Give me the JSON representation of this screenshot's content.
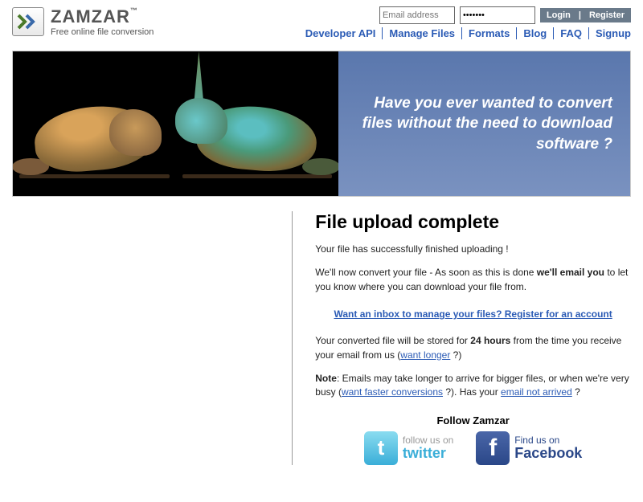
{
  "brand": {
    "name": "ZAMZAR",
    "tm": "™",
    "tagline": "Free online file conversion"
  },
  "login": {
    "email_placeholder": "Email address",
    "password_value": "•••••••",
    "login_btn": "Login",
    "sep": "|",
    "register_btn": "Register"
  },
  "nav": {
    "items": [
      "Developer API",
      "Manage Files",
      "Formats",
      "Blog",
      "FAQ",
      "Signup"
    ]
  },
  "hero": {
    "text": "Have you ever wanted to convert files without the need to download software ?"
  },
  "content": {
    "heading": "File upload complete",
    "p1": "Your file has successfully finished uploading !",
    "p2a": "We'll now convert your file - As soon as this is done ",
    "p2b": "we'll email you",
    "p2c": " to let you know where you can download your file from.",
    "register_link": "Want an inbox to manage your files? Register for an account",
    "p3a": "Your converted file will be stored for ",
    "p3b": "24 hours",
    "p3c": " from the time you receive your email from us (",
    "p3link": "want longer",
    "p3d": " ?)",
    "p4a": "Note",
    "p4b": ": Emails may take longer to arrive for bigger files, or when we're very busy (",
    "p4link1": "want faster conversions",
    "p4c": " ?). Has your ",
    "p4link2": "email not arrived",
    "p4d": " ?"
  },
  "follow": {
    "heading": "Follow Zamzar",
    "twitter_top": "follow us on",
    "twitter_bot": "twitter",
    "facebook_top": "Find us on",
    "facebook_bot": "Facebook"
  }
}
